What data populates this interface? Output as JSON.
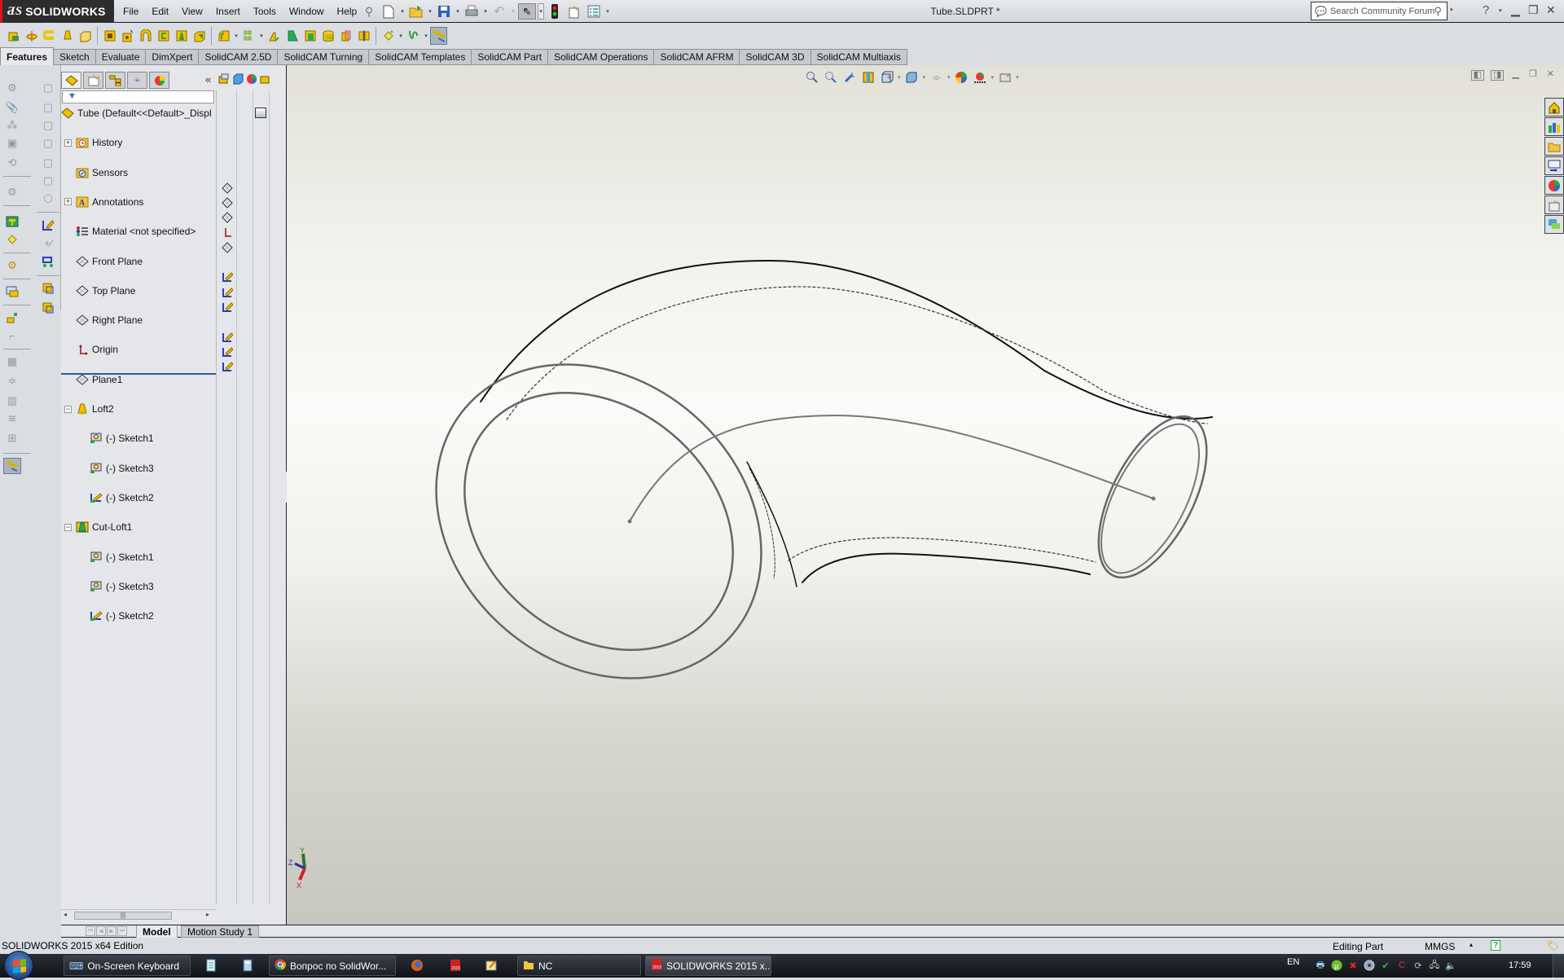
{
  "app": {
    "brand": "SOLIDWORKS",
    "document_title": "Tube.SLDPRT *",
    "edition": "SOLIDWORKS 2015 x64 Edition"
  },
  "menu": [
    "File",
    "Edit",
    "View",
    "Insert",
    "Tools",
    "Window",
    "Help"
  ],
  "quick_access": [
    {
      "icon": "pin-icon"
    },
    {
      "icon": "new-document-icon",
      "dropdown": true
    },
    {
      "icon": "open-icon",
      "dropdown": true
    },
    {
      "icon": "save-icon",
      "dropdown": true
    },
    {
      "icon": "print-icon",
      "dropdown": true
    },
    {
      "icon": "undo-icon",
      "dropdown": true
    },
    {
      "icon": "select-icon",
      "dropdown": true
    },
    {
      "icon": "rebuild-icon"
    },
    {
      "icon": "file-properties-icon"
    },
    {
      "icon": "options-icon",
      "dropdown": true
    }
  ],
  "search": {
    "placeholder": "Search Community Forum"
  },
  "command_tabs": [
    {
      "label": "Features",
      "active": true
    },
    {
      "label": "Sketch"
    },
    {
      "label": "Evaluate"
    },
    {
      "label": "DimXpert"
    },
    {
      "label": "SolidCAM 2.5D"
    },
    {
      "label": "SolidCAM Turning"
    },
    {
      "label": "SolidCAM Templates"
    },
    {
      "label": "SolidCAM Part"
    },
    {
      "label": "SolidCAM Operations"
    },
    {
      "label": "SolidCAM AFRM"
    },
    {
      "label": "SolidCAM 3D"
    },
    {
      "label": "SolidCAM Multiaxis"
    }
  ],
  "feature_toolbar": [
    "extruded-boss-icon",
    "revolved-boss-icon",
    "swept-boss-icon",
    "lofted-boss-icon",
    "boundary-boss-icon",
    "extruded-cut-icon",
    "hole-wizard-icon",
    "revolved-cut-icon",
    "swept-cut-icon",
    "lofted-cut-icon",
    "boundary-cut-icon",
    "fillet-icon",
    "linear-pattern-icon",
    "rib-icon",
    "draft-icon",
    "shell-icon",
    "wrap-icon",
    "intersect-icon",
    "mirror-icon",
    "reference-geometry-icon",
    "curves-icon",
    "instant3d-icon"
  ],
  "feature_tree": {
    "root": "Tube  (Default<<Default>_Displ",
    "items": [
      {
        "label": "History",
        "icon": "history-folder-icon",
        "expandable": true,
        "level": 1
      },
      {
        "label": "Sensors",
        "icon": "sensors-folder-icon",
        "level": 1
      },
      {
        "label": "Annotations",
        "icon": "annotations-icon",
        "expandable": true,
        "level": 1
      },
      {
        "label": "Material <not specified>",
        "icon": "material-icon",
        "level": 1
      },
      {
        "label": "Front Plane",
        "icon": "plane-icon",
        "level": 1
      },
      {
        "label": "Top Plane",
        "icon": "plane-icon",
        "level": 1
      },
      {
        "label": "Right Plane",
        "icon": "plane-icon",
        "level": 1
      },
      {
        "label": "Origin",
        "icon": "origin-icon",
        "level": 1
      },
      {
        "label": "Plane1",
        "icon": "plane-icon",
        "level": 1
      },
      {
        "label": "Loft2",
        "icon": "loft-icon",
        "expanded": true,
        "level": 1
      },
      {
        "label": "(-) Sketch1",
        "icon": "sketch-icon",
        "level": 2
      },
      {
        "label": "(-) Sketch3",
        "icon": "sketch-icon",
        "level": 2
      },
      {
        "label": "(-) Sketch2",
        "icon": "sketch-3d-icon",
        "level": 2
      },
      {
        "label": "Cut-Loft1",
        "icon": "cut-loft-icon",
        "expanded": true,
        "level": 1
      },
      {
        "label": "(-) Sketch1",
        "icon": "sketch-icon",
        "level": 2
      },
      {
        "label": "(-) Sketch3",
        "icon": "sketch-icon",
        "level": 2
      },
      {
        "label": "(-) Sketch2",
        "icon": "sketch-3d-icon",
        "level": 2
      }
    ]
  },
  "bottom_tabs": [
    {
      "label": "Model",
      "active": true
    },
    {
      "label": "Motion Study 1"
    }
  ],
  "status": {
    "mode": "Editing Part",
    "units": "MMGS"
  },
  "triad": {
    "x": "X",
    "y": "Y",
    "z": "Z"
  },
  "taskbar": {
    "buttons": [
      {
        "label": "On-Screen Keyboard"
      },
      {
        "label": "Вопрос по SolidWor..."
      },
      {
        "label": "NC"
      },
      {
        "label": "SOLIDWORKS 2015 x...",
        "active": true
      }
    ],
    "language": "EN",
    "clock": "17:59"
  }
}
